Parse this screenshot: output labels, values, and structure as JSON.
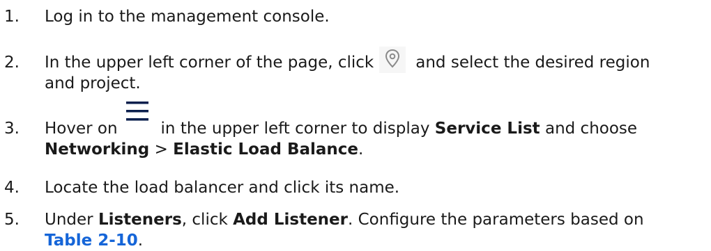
{
  "steps": [
    {
      "num": "1.",
      "text": "Log in to the management console."
    },
    {
      "num": "2.",
      "before_icon": "In the upper left corner of the page, click",
      "icon": "location-pin-icon",
      "after_icon_line1": "and select the desired region",
      "line2": "and project."
    },
    {
      "num": "3.",
      "before_icon": "Hover on",
      "icon": "hamburger-menu-icon",
      "after_icon": "in the upper left corner to display",
      "bold1": "Service List",
      "mid": "and choose",
      "bold2": "Networking",
      "sep": ">",
      "bold3": "Elastic Load Balance",
      "end": "."
    },
    {
      "num": "4.",
      "text": "Locate the load balancer and click its name."
    },
    {
      "num": "5.",
      "before": "Under",
      "bold1": "Listeners",
      "mid": ", click",
      "bold2": "Add Listener",
      "after": ". Configure the parameters based on",
      "link": "Table 2-10",
      "end": "."
    }
  ],
  "colors": {
    "text": "#1a1a1a",
    "link": "#1565d8",
    "icon_gray": "#8a8a8a",
    "hamburger_blue": "#0b1f4d"
  }
}
